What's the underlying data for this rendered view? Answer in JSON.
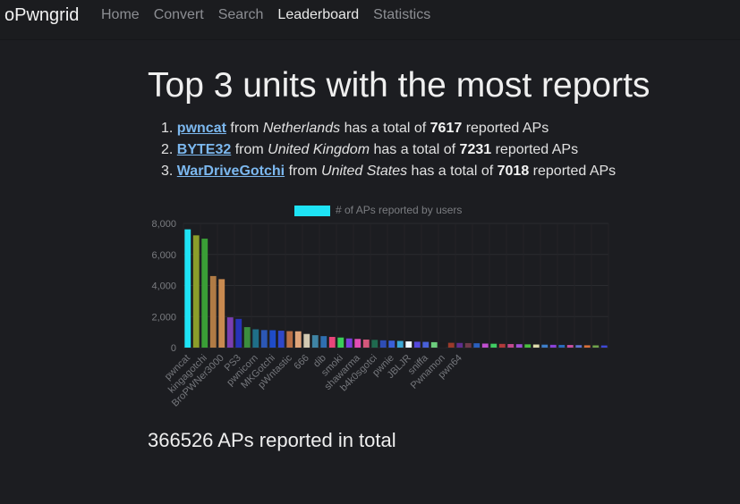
{
  "nav": {
    "brand": "oPwngrid",
    "links": [
      "Home",
      "Convert",
      "Search",
      "Leaderboard",
      "Statistics"
    ],
    "active": "Leaderboard"
  },
  "page": {
    "title": "Top 3 units with the most reports",
    "top_units": [
      {
        "name": "pwncat",
        "country": "Netherlands",
        "total": "7617"
      },
      {
        "name": "BYTE32",
        "country": "United Kingdom",
        "total": "7231"
      },
      {
        "name": "WarDriveGotchi",
        "country": "United States",
        "total": "7018"
      }
    ],
    "text_from": "from",
    "text_has_total": "has a total of",
    "text_reported": "reported APs",
    "total_line": "366526 APs reported in total"
  },
  "chart_data": {
    "type": "bar",
    "legend": "# of APs reported by users",
    "legend_color": "#1ee3f5",
    "ylim": [
      0,
      8000
    ],
    "yticks": [
      "0",
      "2,000",
      "4,000",
      "6,000",
      "8,000"
    ],
    "grid": true,
    "categories": [
      "pwncat",
      "",
      "kingagotchi",
      "",
      "BroPWNer3000",
      "",
      "PS3",
      "",
      "pwnicorn",
      "",
      "MKGotchi",
      "",
      "pWntastic",
      "",
      "666",
      "",
      "dib",
      "",
      "smoki",
      "",
      "shawarma",
      "",
      "b4k0sgotci",
      "",
      "pwnie",
      "",
      "JBLJR",
      "",
      "sniffa",
      "",
      "Pwnamon",
      "",
      "pwn64",
      ""
    ],
    "values": [
      7617,
      7231,
      7018,
      4610,
      4410,
      1950,
      1850,
      1320,
      1180,
      1130,
      1120,
      1090,
      1060,
      1050,
      880,
      800,
      740,
      690,
      650,
      590,
      560,
      520,
      500,
      470,
      450,
      430,
      400,
      380,
      370,
      350,
      330,
      310,
      300,
      290,
      280,
      260,
      250,
      240,
      230,
      220,
      210,
      200,
      190,
      180,
      175,
      170,
      160,
      150,
      145,
      140
    ],
    "colors": [
      "#1ee3f5",
      "#8c9e2a",
      "#3a9e36",
      "#b07b45",
      "#c98a50",
      "#7a3fb0",
      "#2733b8",
      "#3c8e3e",
      "#1f6f88",
      "#2c57b5",
      "#1f4cc8",
      "#2f47c8",
      "#b87046",
      "#e0a57a",
      "#d2c9b2",
      "#3f84a4",
      "#2f6fb0",
      "#e8457a",
      "#3acd59",
      "#7b3dd9",
      "#e34db4",
      "#d4577b",
      "#1f6a4f",
      "#2e4db5",
      "#3a5fd8",
      "#3ba7d5",
      "#ecf6ff",
      "#5548dd",
      "#4860d8",
      "#6ccd7d",
      "#1b1c1f",
      "#9a3a2a",
      "#5f2e8e",
      "#6f3a4a",
      "#2a5fbd",
      "#c04fd0",
      "#40cc63",
      "#b03a3a",
      "#c0498e",
      "#a04fd6",
      "#4ac040",
      "#dedbac",
      "#3e7ec8",
      "#8b43d8",
      "#2a6bbd",
      "#c94fa0",
      "#5d73d1",
      "#d76f3a",
      "#6fa24b",
      "#3f48d6"
    ]
  }
}
